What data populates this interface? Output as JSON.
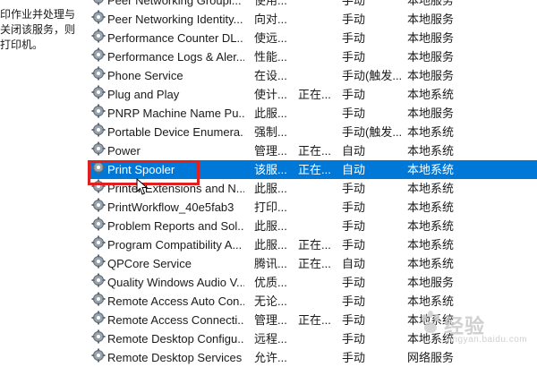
{
  "description_panel": {
    "lines": [
      "印作业并处理与",
      "关闭该服务，则",
      "打印机。"
    ]
  },
  "services": [
    {
      "name": "Peer Networking Groupi...",
      "desc": "使用...",
      "status": "",
      "start": "手动",
      "logon": "本地服务"
    },
    {
      "name": "Peer Networking Identity...",
      "desc": "向对...",
      "status": "",
      "start": "手动",
      "logon": "本地服务"
    },
    {
      "name": "Performance Counter DL...",
      "desc": "使远...",
      "status": "",
      "start": "手动",
      "logon": "本地服务"
    },
    {
      "name": "Performance Logs & Aler...",
      "desc": "性能...",
      "status": "",
      "start": "手动",
      "logon": "本地服务"
    },
    {
      "name": "Phone Service",
      "desc": "在设...",
      "status": "",
      "start": "手动(触发...",
      "logon": "本地服务"
    },
    {
      "name": "Plug and Play",
      "desc": "使计...",
      "status": "正在...",
      "start": "手动",
      "logon": "本地系统"
    },
    {
      "name": "PNRP Machine Name Pu...",
      "desc": "此服...",
      "status": "",
      "start": "手动",
      "logon": "本地服务"
    },
    {
      "name": "Portable Device Enumera...",
      "desc": "强制...",
      "status": "",
      "start": "手动(触发...",
      "logon": "本地系统"
    },
    {
      "name": "Power",
      "desc": "管理...",
      "status": "正在...",
      "start": "自动",
      "logon": "本地系统"
    },
    {
      "name": "Print Spooler",
      "desc": "该服...",
      "status": "正在...",
      "start": "自动",
      "logon": "本地系统"
    },
    {
      "name": "Printer Extensions and N...",
      "desc": "此服...",
      "status": "",
      "start": "手动",
      "logon": "本地系统"
    },
    {
      "name": "PrintWorkflow_40e5fab3",
      "desc": "打印...",
      "status": "",
      "start": "手动",
      "logon": "本地系统"
    },
    {
      "name": "Problem Reports and Sol...",
      "desc": "此服...",
      "status": "",
      "start": "手动",
      "logon": "本地系统"
    },
    {
      "name": "Program Compatibility A...",
      "desc": "此服...",
      "status": "正在...",
      "start": "手动",
      "logon": "本地系统"
    },
    {
      "name": "QPCore Service",
      "desc": "腾讯...",
      "status": "正在...",
      "start": "自动",
      "logon": "本地系统"
    },
    {
      "name": "Quality Windows Audio V...",
      "desc": "优质...",
      "status": "",
      "start": "手动",
      "logon": "本地服务"
    },
    {
      "name": "Remote Access Auto Con...",
      "desc": "无论...",
      "status": "",
      "start": "手动",
      "logon": "本地系统"
    },
    {
      "name": "Remote Access Connecti...",
      "desc": "管理...",
      "status": "正在...",
      "start": "手动",
      "logon": "本地系统"
    },
    {
      "name": "Remote Desktop Configu...",
      "desc": "远程...",
      "status": "",
      "start": "手动",
      "logon": "本地系统"
    },
    {
      "name": "Remote Desktop Services",
      "desc": "允许...",
      "status": "",
      "start": "手动",
      "logon": "网络服务"
    }
  ],
  "watermark": {
    "text": "经验",
    "url": "jingyan.baidu.com"
  }
}
